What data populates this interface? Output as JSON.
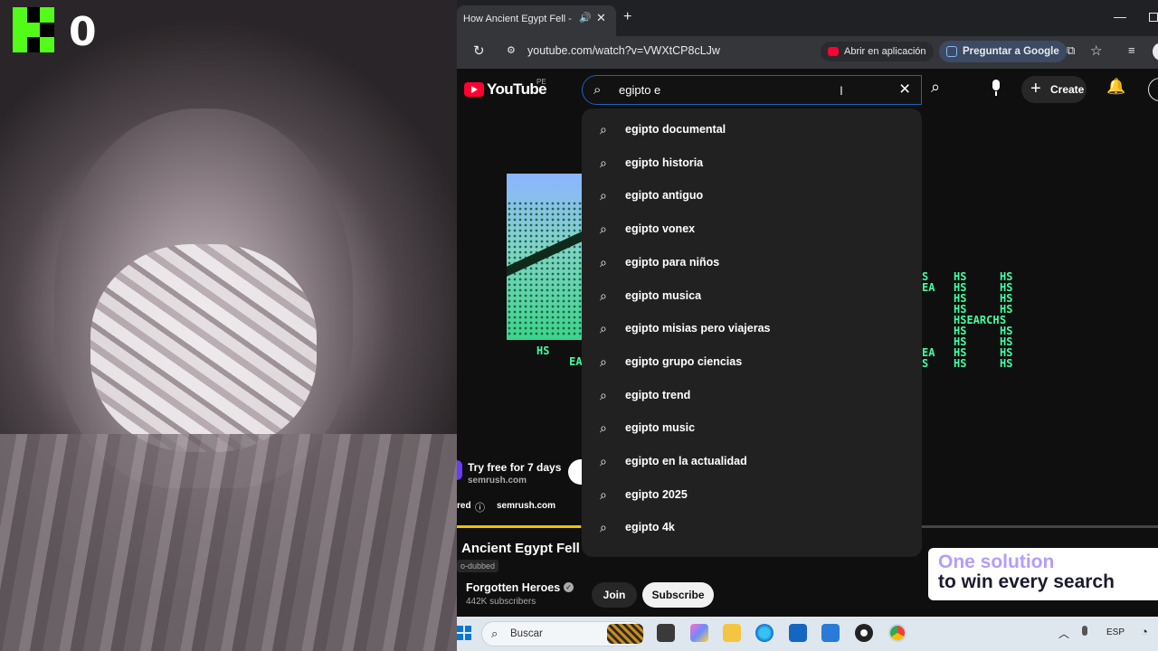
{
  "overlay": {
    "kick_count": "0"
  },
  "browser": {
    "tab_title": "How Ancient Egypt Fell - YouTube",
    "new_tab": "+",
    "url": "youtube.com/watch?v=VWXtCP8cLJw",
    "open_in_app": "Abrir en aplicación",
    "ask_google": "Preguntar a Google"
  },
  "youtube": {
    "logo_text": "YouTube",
    "region": "PE",
    "search_value": "egipto e",
    "create_label": "Create",
    "suggestions": [
      "egipto documental",
      "egipto historia",
      "egipto antiguo",
      "egipto vonex",
      "egipto para niños",
      "egipto musica",
      "egipto misias pero viajeras",
      "egipto grupo ciencias",
      "egipto trend",
      "egipto music",
      "egipto en la actualidad",
      "egipto 2025",
      "egipto 4k"
    ],
    "ad": {
      "cta_title": "Try free for 7 days",
      "cta_domain": "semrush.com",
      "sponsored": "red",
      "sponsored_info": "ⓘ",
      "sponsored_domain": "semrush.com",
      "banner_line1": "One solution",
      "banner_line2": "to win every search",
      "art_left": "HS\n     EARC",
      "art_right_1": "S\nEA\n\n\n\n\n\nEA\nS",
      "art_right_2": "HS\nHS\nHS\nHS\nHSEARCH\nHS\nHS\nHS\nHS",
      "art_right_3": "HS\nHS\nHS\nHS\nS\nHS\nHS\nHS\nHS"
    },
    "player_progress": 0.177,
    "video": {
      "title": "Ancient Egypt Fell",
      "dub_badge": "o-dubbed",
      "channel": "Forgotten Heroes",
      "subscribers": "442K subscribers",
      "join": "Join",
      "subscribe": "Subscribe"
    }
  },
  "taskbar": {
    "search_placeholder": "Buscar",
    "lang": "ESP"
  },
  "icons": {
    "accent_youtube": "#ff0033",
    "accent_kick": "#53fc18",
    "search_focus": "#1c62b9"
  }
}
